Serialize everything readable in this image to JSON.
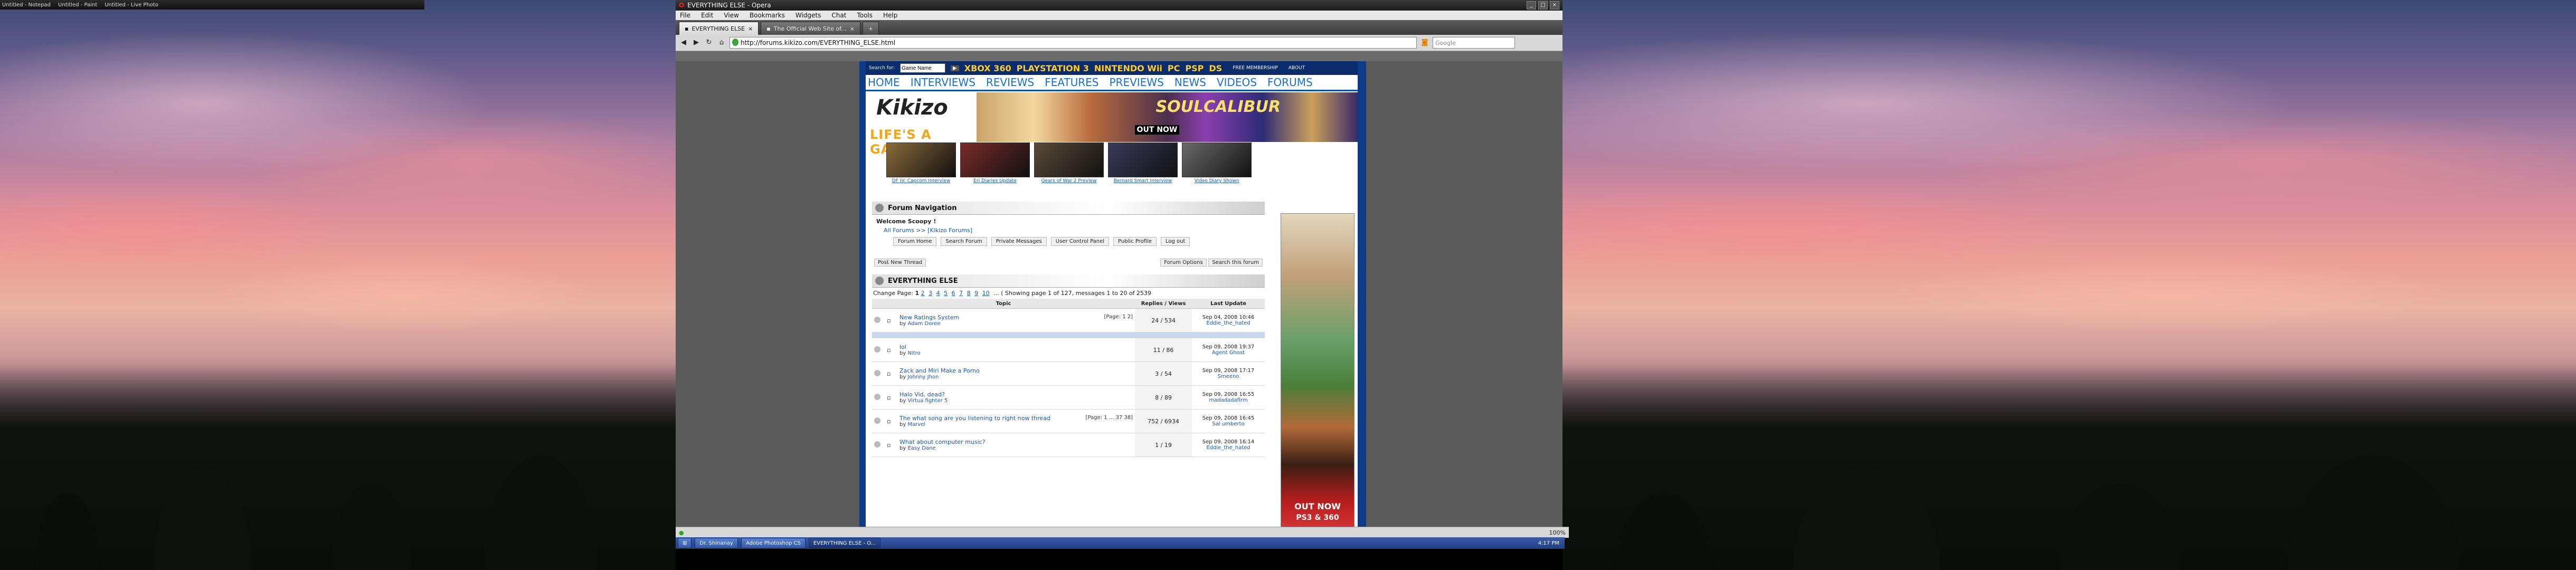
{
  "window": {
    "title": "EVERYTHING ELSE - Opera"
  },
  "left_taskbar": [
    "Untitled - Notepad",
    "Untitled - Paint",
    "Untitled - Live Photo"
  ],
  "menu": [
    "File",
    "Edit",
    "View",
    "Bookmarks",
    "Widgets",
    "Chat",
    "Tools",
    "Help"
  ],
  "tabs": [
    {
      "label": "EVERYTHING ELSE"
    },
    {
      "label": "The Official Web Site of..."
    }
  ],
  "address": {
    "url": "http://forums.kikizo.com/EVERYTHING_ELSE.html"
  },
  "search": {
    "placeholder": "Google"
  },
  "topstrip": {
    "label": "Search for:",
    "field_value": "Game Name",
    "platforms": [
      "XBOX 360",
      "PLAYSTATION 3",
      "NINTENDO Wii",
      "PC",
      "PSP",
      "DS"
    ],
    "links": [
      "FREE MEMBERSHIP",
      "ABOUT"
    ]
  },
  "nav": [
    "HOME",
    "INTERVIEWS",
    "REVIEWS",
    "FEATURES",
    "PREVIEWS",
    "NEWS",
    "VIDEOS",
    "FORUMS"
  ],
  "logo": {
    "word": "Kikizo",
    "tag": "LIFE'S A GAME"
  },
  "banner": {
    "title": "SOULCALIBUR",
    "sub": "OUT NOW"
  },
  "thumbs": [
    {
      "cap": "DF IV: Capcom Interview",
      "color": "#8a6a3a"
    },
    {
      "cap": "Eri Diaries Update",
      "color": "#7a2a2a"
    },
    {
      "cap": "Gears of War 2 Preview",
      "color": "#5a4a3a"
    },
    {
      "cap": "Bernard Smart Interview",
      "color": "#3a3a5a"
    },
    {
      "cap": "Video Diary Shown",
      "color": "#6a6a6a"
    }
  ],
  "forum_nav": {
    "title": "Forum Navigation",
    "welcome": "Welcome Scoopy !",
    "breadcrumb": "All Forums >> [Kikizo Forums]",
    "buttons": [
      "Forum Home",
      "Search Forum",
      "Private Messages",
      "User Control Panel",
      "Public Profile",
      "Log out"
    ]
  },
  "tools": {
    "left": "Post New Thread",
    "right1": "Forum Options",
    "right2": "Search this forum"
  },
  "forum": {
    "title": "EVERYTHING ELSE",
    "change_page": "Change Page:",
    "pages": [
      "1",
      "2",
      "3",
      "4",
      "5",
      "6",
      "7",
      "8",
      "9",
      "10"
    ],
    "ellipsis": "...",
    "showing": "( Showing page 1 of 127, messages 1 to 20 of 2539",
    "col_topic": "Topic",
    "col_replies": "Replies / Views",
    "col_last": "Last Update"
  },
  "threads": [
    {
      "title": "New Ratings System",
      "by": "Adam Doree",
      "pages": "[Page: 1 2]",
      "replies": "24 / 534",
      "date": "Sep 04, 2008 10:46",
      "user": "Eddie_the_hated"
    },
    {
      "title": "lol",
      "by": "Nitro",
      "pages": "",
      "replies": "11 / 86",
      "date": "Sep 09, 2008 19:37",
      "user": "Agent Ghost"
    },
    {
      "title": "Zack and Miri Make a Porno",
      "by": "Johnny Jhon",
      "pages": "",
      "replies": "3 / 54",
      "date": "Sep 09, 2008 17:17",
      "user": "Smeeno"
    },
    {
      "title": "Halo Vid, dead?",
      "by": "Virtua fighter 5",
      "pages": "",
      "replies": "8 / 89",
      "date": "Sep 09, 2008 16:55",
      "user": "madadadafirm"
    },
    {
      "title": "The what song are you listening to right now thread",
      "by": "Marvel",
      "pages": "[Page: 1 ... 37 38]",
      "replies": "752 / 6934",
      "date": "Sep 09, 2008 16:45",
      "user": "Sal umberto"
    },
    {
      "title": "What about computer music?",
      "by": "Easy Dane",
      "pages": "",
      "replies": "1 / 19",
      "date": "Sep 09, 2008 16:14",
      "user": "Eddie_the_hated"
    }
  ],
  "right_ad": {
    "line1": "OUT NOW",
    "line2": "PS3 & 360"
  },
  "status": {
    "zoom": "100%"
  },
  "taskbar": [
    {
      "label": "Dr. Shinanay"
    },
    {
      "label": "Adobe Photoshop CS"
    },
    {
      "label": "EVERYTHING ELSE - O..."
    }
  ],
  "clock": "4:17 PM"
}
